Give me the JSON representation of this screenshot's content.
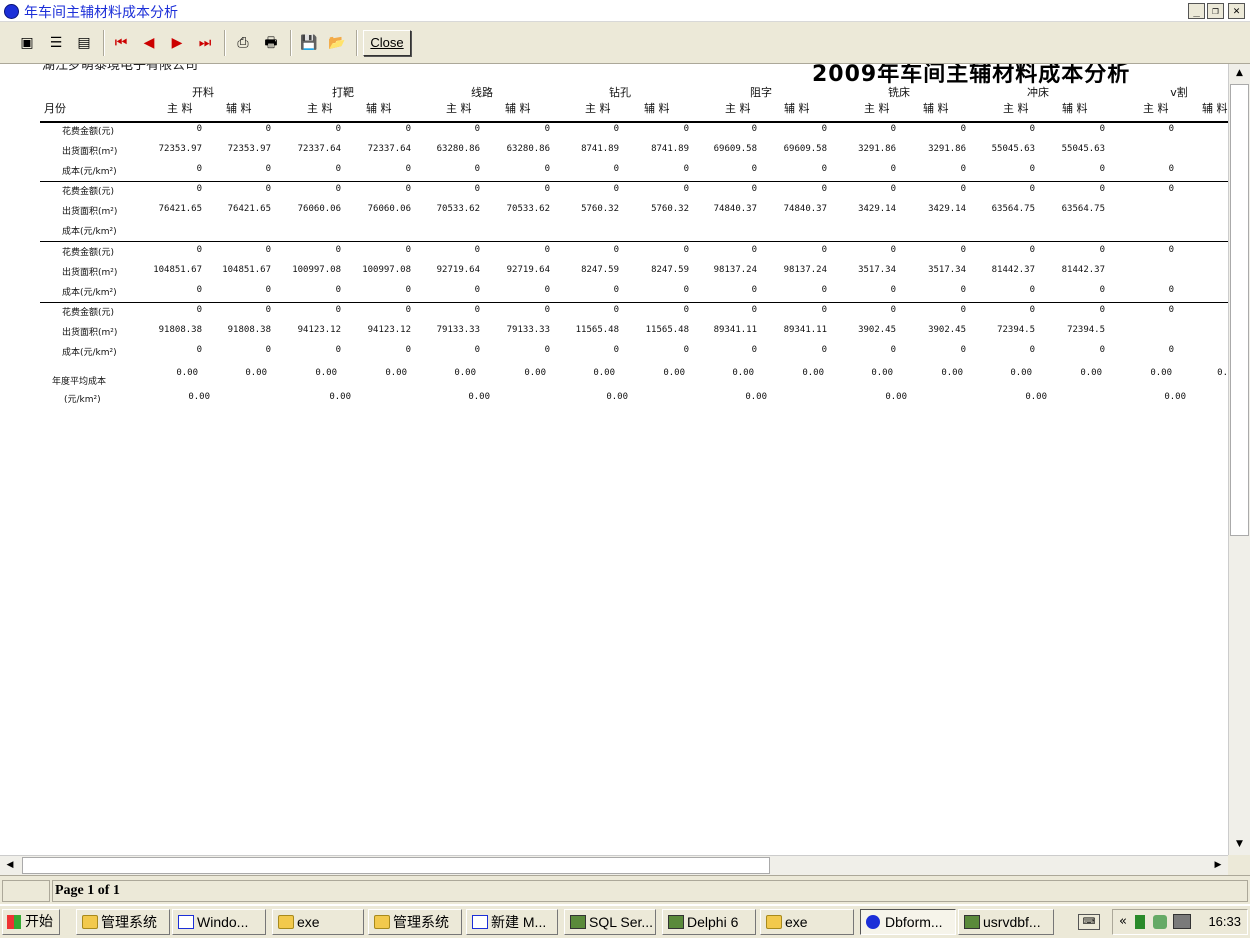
{
  "window": {
    "title": "年车间主辅材料成本分析",
    "min_label": "_",
    "restore_label": "❐",
    "close_label": "✕"
  },
  "toolbar": {
    "close_label": "Close",
    "icons": [
      "whole-page-icon",
      "page-width-icon",
      "100-percent-icon",
      "first-page-icon",
      "prior-page-icon",
      "next-page-icon",
      "last-page-icon",
      "printer-setup-icon",
      "print-icon",
      "save-icon",
      "open-icon"
    ]
  },
  "report": {
    "company": "湖江罗萌泰境电子有限公司",
    "title": "2009年车间主辅材料成本分析",
    "month_header": "月份",
    "groups": [
      "开料",
      "打靶",
      "线路",
      "钻孔",
      "阻字",
      "铣床",
      "冲床",
      "v割"
    ],
    "sub_headers": [
      "主 料",
      "辅 料"
    ],
    "row_labels": [
      "花费金额(元)",
      "出货面积(m²)",
      "成本(元/km²)"
    ],
    "blocks": [
      {
        "spend": [
          "0",
          "0",
          "0",
          "0",
          "0",
          "0",
          "0",
          "0",
          "0",
          "0",
          "0",
          "0",
          "0",
          "0",
          "0"
        ],
        "area": [
          "72353.97",
          "72353.97",
          "72337.64",
          "72337.64",
          "63280.86",
          "63280.86",
          "8741.89",
          "8741.89",
          "69609.58",
          "69609.58",
          "3291.86",
          "3291.86",
          "55045.63",
          "55045.63",
          ""
        ],
        "cost": [
          "0",
          "0",
          "0",
          "0",
          "0",
          "0",
          "0",
          "0",
          "0",
          "0",
          "0",
          "0",
          "0",
          "0",
          "0"
        ]
      },
      {
        "spend": [
          "0",
          "0",
          "0",
          "0",
          "0",
          "0",
          "0",
          "0",
          "0",
          "0",
          "0",
          "0",
          "0",
          "0",
          "0"
        ],
        "area": [
          "76421.65",
          "76421.65",
          "76060.06",
          "76060.06",
          "70533.62",
          "70533.62",
          "5760.32",
          "5760.32",
          "74840.37",
          "74840.37",
          "3429.14",
          "3429.14",
          "63564.75",
          "63564.75",
          ""
        ],
        "cost": [
          "",
          "",
          "",
          "",
          "",
          "",
          "",
          "",
          "",
          "",
          "",
          "",
          "",
          "",
          ""
        ]
      },
      {
        "spend": [
          "0",
          "0",
          "0",
          "0",
          "0",
          "0",
          "0",
          "0",
          "0",
          "0",
          "0",
          "0",
          "0",
          "0",
          "0"
        ],
        "area": [
          "104851.67",
          "104851.67",
          "100997.08",
          "100997.08",
          "92719.64",
          "92719.64",
          "8247.59",
          "8247.59",
          "98137.24",
          "98137.24",
          "3517.34",
          "3517.34",
          "81442.37",
          "81442.37",
          ""
        ],
        "cost": [
          "0",
          "0",
          "0",
          "0",
          "0",
          "0",
          "0",
          "0",
          "0",
          "0",
          "0",
          "0",
          "0",
          "0",
          "0"
        ]
      },
      {
        "spend": [
          "0",
          "0",
          "0",
          "0",
          "0",
          "0",
          "0",
          "0",
          "0",
          "0",
          "0",
          "0",
          "0",
          "0",
          "0"
        ],
        "area": [
          "91808.38",
          "91808.38",
          "94123.12",
          "94123.12",
          "79133.33",
          "79133.33",
          "11565.48",
          "11565.48",
          "89341.11",
          "89341.11",
          "3902.45",
          "3902.45",
          "72394.5",
          "72394.5",
          ""
        ],
        "cost": [
          "0",
          "0",
          "0",
          "0",
          "0",
          "0",
          "0",
          "0",
          "0",
          "0",
          "0",
          "0",
          "0",
          "0",
          "0"
        ]
      }
    ],
    "annual_label_1": "年度平均成本",
    "annual_label_2": "(元/km²)",
    "annual_row1": [
      "0.00",
      "0.00",
      "0.00",
      "0.00",
      "0.00",
      "0.00",
      "0.00",
      "0.00",
      "0.00",
      "0.00",
      "0.00",
      "0.00",
      "0.00",
      "0.00",
      "0.00",
      "0."
    ],
    "annual_row2": [
      "0.00",
      "0.00",
      "0.00",
      "0.00",
      "0.00",
      "0.00",
      "0.00",
      "0.00"
    ]
  },
  "status": {
    "page_text": "Page 1 of 1"
  },
  "taskbar": {
    "start_label": "开始",
    "tasks": [
      {
        "label": "管理系统",
        "icon": "folder-icon"
      },
      {
        "label": "Windo...",
        "icon": "computer-icon"
      },
      {
        "label": "exe",
        "icon": "folder-icon"
      },
      {
        "label": "管理系统",
        "icon": "folder-icon"
      },
      {
        "label": "新建 M...",
        "icon": "document-icon"
      },
      {
        "label": "SQL Ser...",
        "icon": "sql-server-icon"
      },
      {
        "label": "Delphi 6",
        "icon": "delphi-icon"
      },
      {
        "label": "exe",
        "icon": "folder-icon"
      },
      {
        "label": "Dbform...",
        "icon": "app-dot-icon"
      },
      {
        "label": "usrvdbf...",
        "icon": "network-icon"
      }
    ],
    "tray_chevron": "«",
    "clock": "16:33"
  }
}
